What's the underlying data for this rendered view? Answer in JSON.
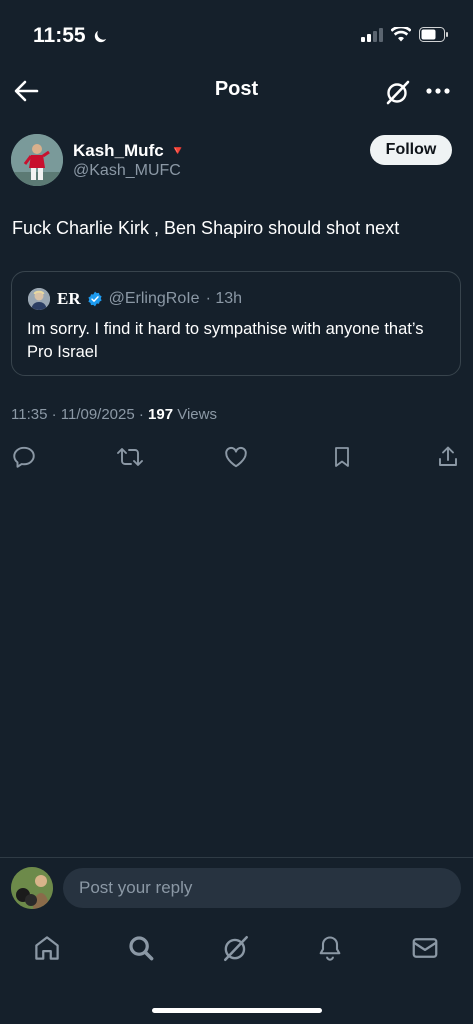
{
  "status_bar": {
    "time": "11:55"
  },
  "header": {
    "title": "Post"
  },
  "author": {
    "name": "Kash_Mufc",
    "badge_emoji": "🔻",
    "handle": "@Kash_MUFC",
    "follow_label": "Follow"
  },
  "post": {
    "text": "Fuck Charlie Kirk , Ben Shapiro should shot next"
  },
  "quote": {
    "name": "ER",
    "handle": "@ErlingRoIe",
    "time": "· 13h",
    "text": "Im sorry. I find it hard to sympathise with anyone that’s Pro Israel"
  },
  "meta": {
    "timestamp": "11:35 · 11/09/2025 · ",
    "views_count": "197",
    "views_label": " Views"
  },
  "reply": {
    "placeholder": "Post your reply"
  },
  "colors": {
    "background": "#15202b",
    "verified": "#1d9bf0",
    "muted": "#8b98a5"
  },
  "icons": [
    "back-arrow-icon",
    "grok-icon",
    "more-icon",
    "reply-icon",
    "repost-icon",
    "like-icon",
    "bookmark-icon",
    "share-icon",
    "home-icon",
    "search-icon",
    "notifications-icon",
    "messages-icon",
    "verified-icon",
    "moon-icon",
    "signal-icon",
    "wifi-icon",
    "battery-icon"
  ]
}
